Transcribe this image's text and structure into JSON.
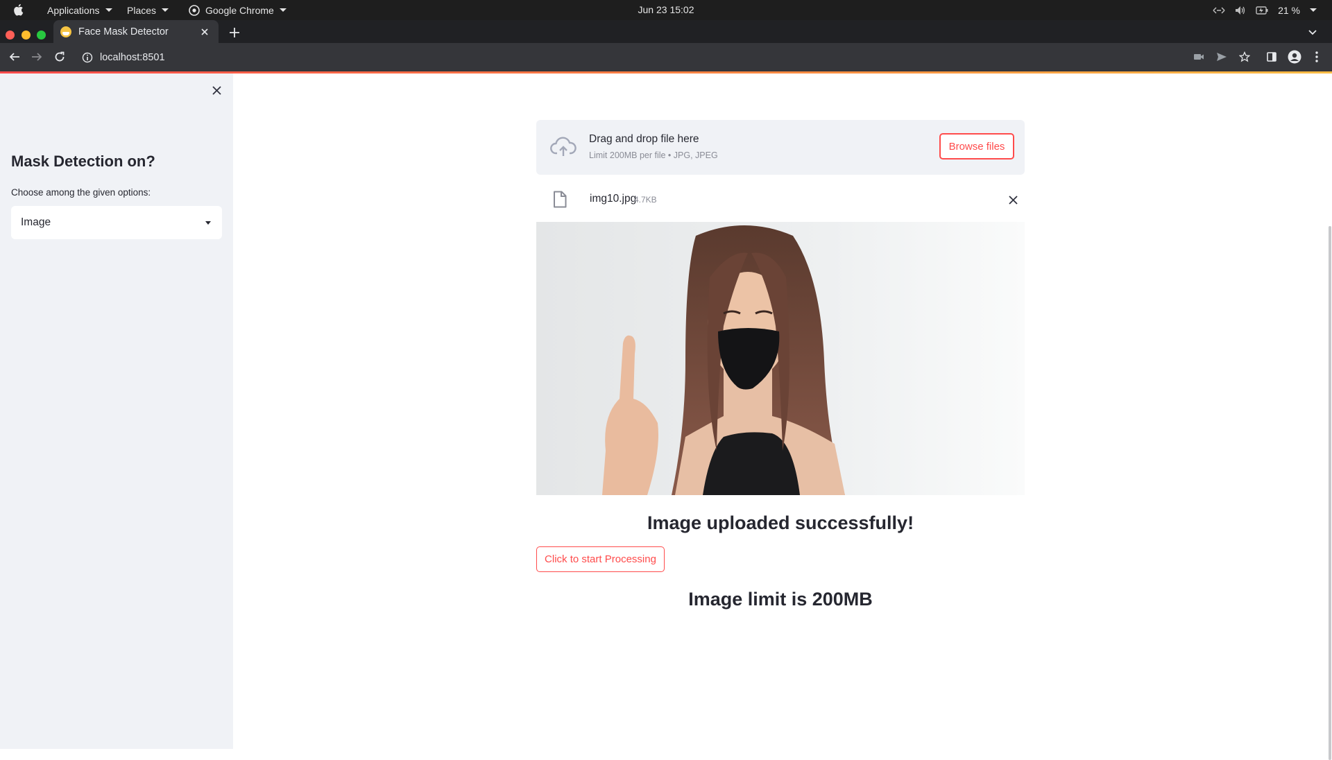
{
  "os": {
    "menus": [
      "Applications",
      "Places",
      "Google Chrome"
    ],
    "clock": "Jun 23  15:02",
    "battery": "21 %"
  },
  "browser": {
    "tab_title": "Face Mask Detector",
    "url": "localhost:8501"
  },
  "sidebar": {
    "title": "Mask Detection on?",
    "select_label": "Choose among the given options:",
    "select_value": "Image"
  },
  "uploader": {
    "drop_title": "Drag and drop file here",
    "drop_subtitle": "Limit 200MB per file • JPG, JPEG",
    "browse_label": "Browse files",
    "file_name": "img10.jpg",
    "file_size": "4.7KB"
  },
  "main": {
    "success_message": "Image uploaded successfully!",
    "process_button": "Click to start Processing",
    "limit_message": "Image limit is 200MB"
  },
  "colors": {
    "accent": "#ff4b4b",
    "sidebar_bg": "#f0f2f6",
    "text": "#262730",
    "chrome_dark": "#202124"
  }
}
